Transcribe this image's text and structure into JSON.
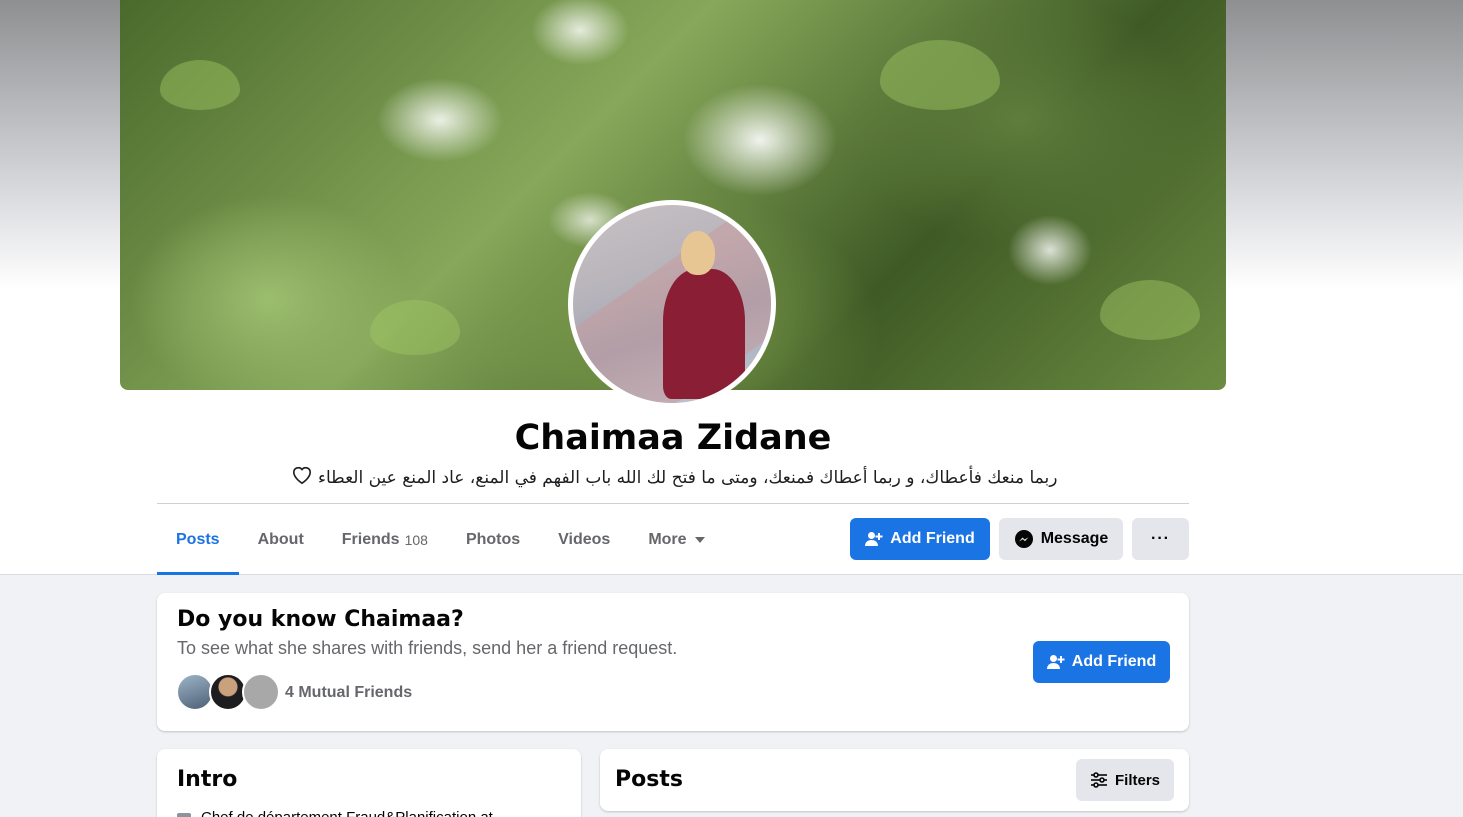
{
  "profile": {
    "name": "Chaimaa Zidane",
    "bio": "ربما منعك فأعطاك، و ربما أعطاك فمنعك، ومتى ما فتح لك الله باب الفهم في المنع، عاد المنع عين العطاء"
  },
  "tabs": [
    {
      "label": "Posts",
      "active": true
    },
    {
      "label": "About"
    },
    {
      "label": "Friends",
      "count": "108"
    },
    {
      "label": "Photos"
    },
    {
      "label": "Videos"
    },
    {
      "label": "More"
    }
  ],
  "actions": {
    "add_friend": "Add Friend",
    "message": "Message",
    "more": "···"
  },
  "know_card": {
    "title": "Do you know Chaimaa?",
    "subtitle": "To see what she shares with friends, send her a friend request.",
    "mutual": "4 Mutual Friends",
    "button": "Add Friend"
  },
  "intro": {
    "title": "Intro",
    "first_line": "Chef de département Fraud&Planification at"
  },
  "posts": {
    "title": "Posts",
    "filters": "Filters"
  },
  "colors": {
    "accent": "#1b74e4",
    "secondary_button": "#e4e6eb",
    "page_background": "#f0f2f5",
    "muted_text": "#65676b"
  }
}
